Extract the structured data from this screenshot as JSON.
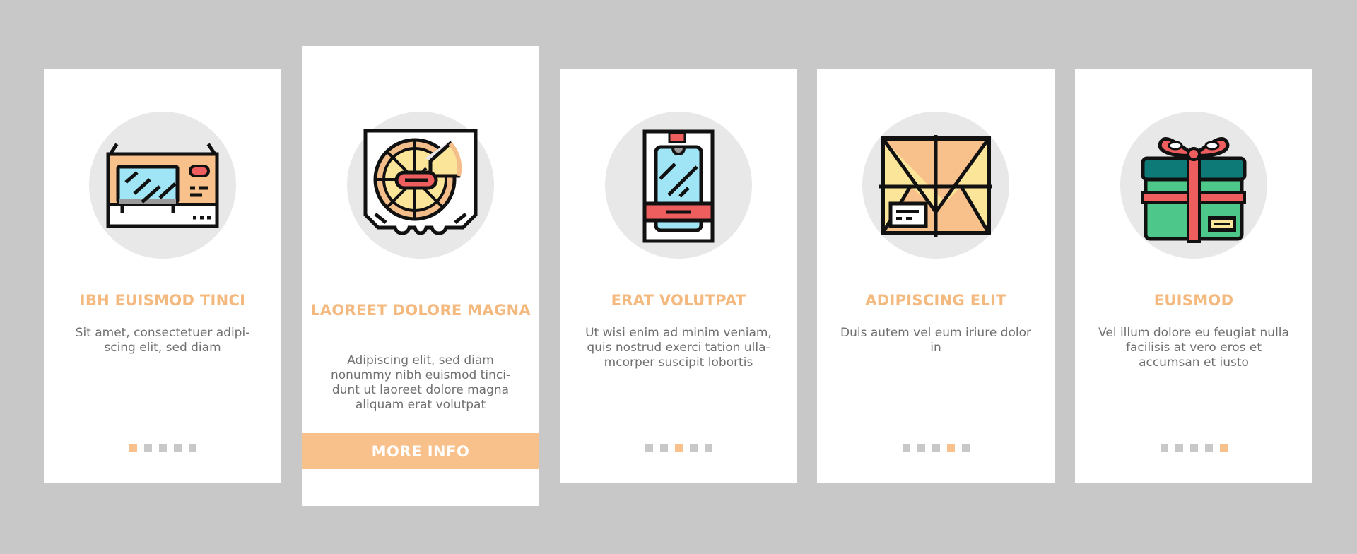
{
  "colors": {
    "background": "#c8c8c8",
    "card": "#ffffff",
    "accent": "#f8c08a",
    "title": "#f4b97e",
    "body_text": "#707070",
    "icon_circle": "#e8e8e8",
    "dot_inactive": "#c8c8c8"
  },
  "cards": [
    {
      "icon": "microwave-icon",
      "title": "IBH EUISMOD TINCI",
      "body": "Sit amet, consectetuer adipi- scing elit, sed diam",
      "dots_total": 5,
      "active_dot": 0
    },
    {
      "icon": "pizza-box-icon",
      "title": "LAOREET DOLORE MAGNA",
      "body": "Adipiscing elit, sed diam nonummy nibh euismod tinci- dunt ut laoreet dolore magna aliquam erat volutpat",
      "button_label": "MORE INFO"
    },
    {
      "icon": "phone-box-icon",
      "title": "ERAT VOLUTPAT",
      "body": "Ut wisi enim ad minim veniam, quis nostrud exerci tation ulla- mcorper suscipit lobortis",
      "dots_total": 5,
      "active_dot": 2
    },
    {
      "icon": "parcel-icon",
      "title": "ADIPISCING ELIT",
      "body": "Duis autem vel eum iriure dolor in",
      "dots_total": 5,
      "active_dot": 3
    },
    {
      "icon": "gift-box-icon",
      "title": "EUISMOD",
      "body": "Vel illum dolore eu feugiat nulla facilisis at vero eros et accumsan et iusto",
      "dots_total": 5,
      "active_dot": 4
    }
  ]
}
